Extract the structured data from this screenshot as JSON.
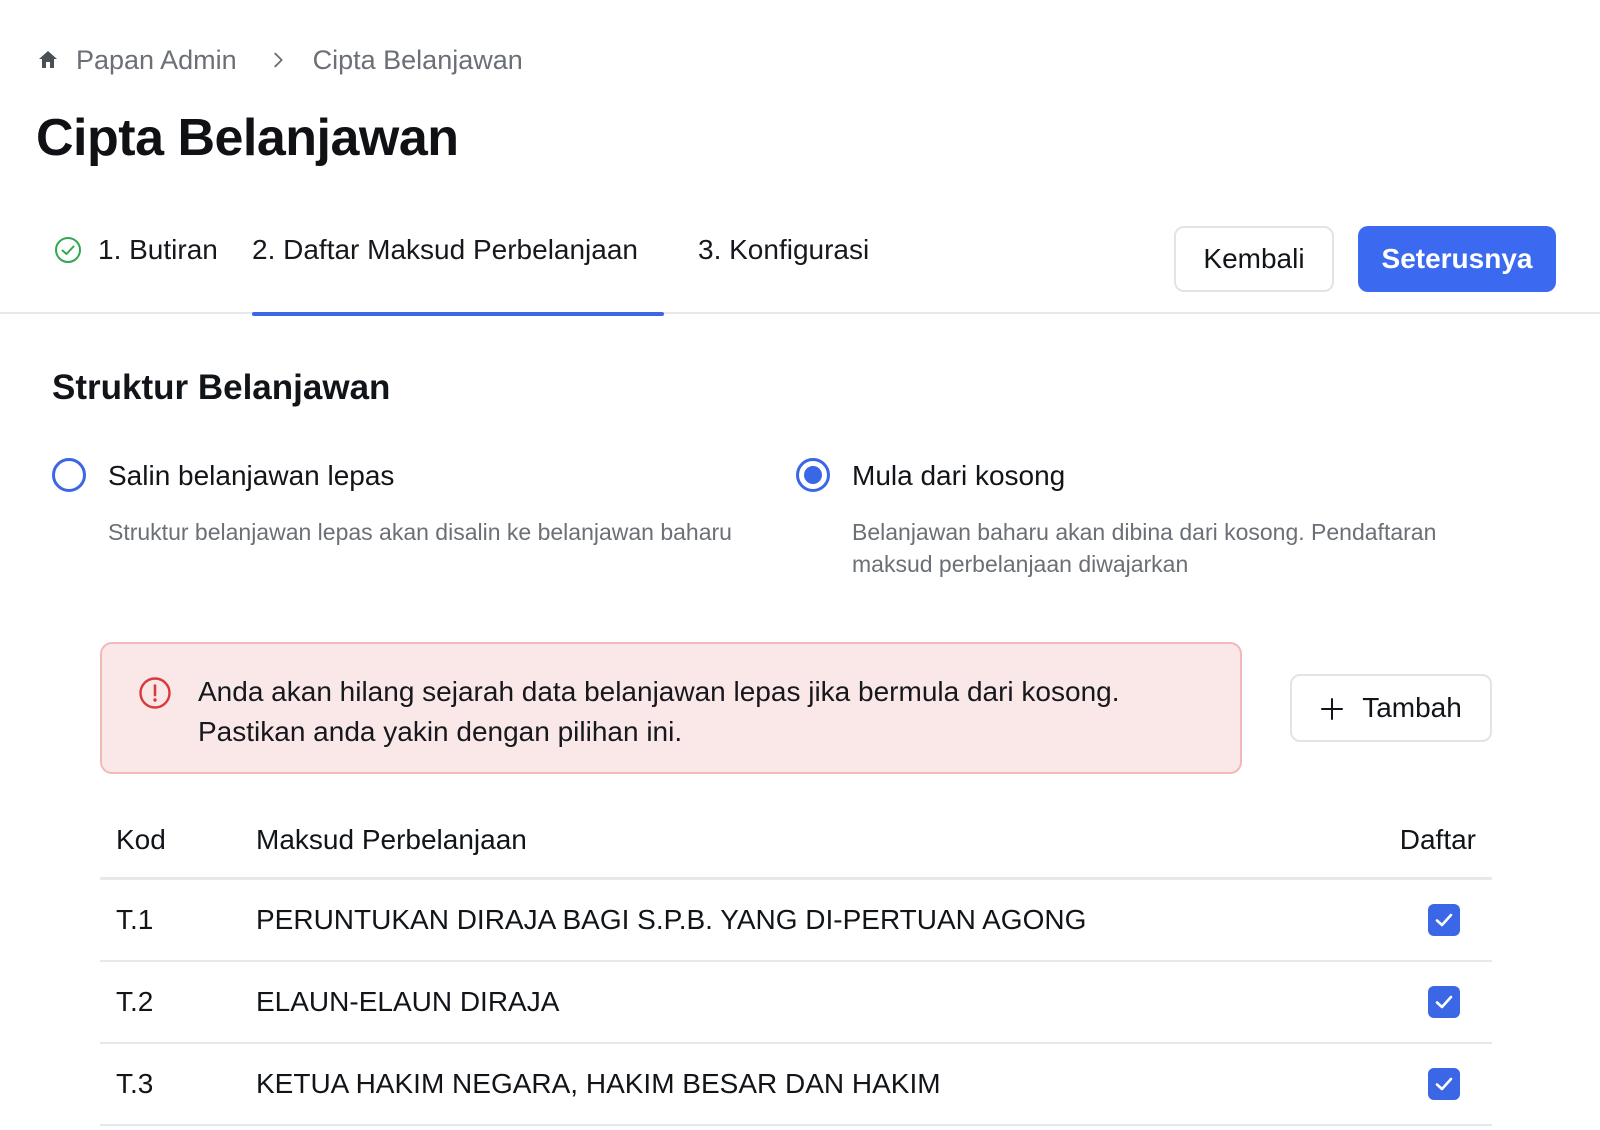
{
  "breadcrumb": {
    "home_label": "Papan Admin",
    "current_label": "Cipta Belanjawan"
  },
  "page": {
    "title": "Cipta Belanjawan"
  },
  "tabs": [
    {
      "label": "1. Butiran",
      "state": "completed"
    },
    {
      "label": "2. Daftar Maksud Perbelanjaan",
      "state": "active"
    },
    {
      "label": "3. Konfigurasi",
      "state": "pending"
    }
  ],
  "actions": {
    "back_label": "Kembali",
    "next_label": "Seterusnya"
  },
  "section": {
    "title": "Struktur Belanjawan"
  },
  "options": [
    {
      "label": "Salin belanjawan lepas",
      "description": "Struktur belanjawan lepas akan disalin ke belanjawan baharu",
      "selected": false
    },
    {
      "label": "Mula dari kosong",
      "description": "Belanjawan baharu akan dibina dari kosong. Pendaftaran maksud perbelanjaan diwajarkan",
      "selected": true
    }
  ],
  "alert": {
    "text": "Anda akan hilang sejarah data belanjawan lepas jika bermula dari kosong. Pastikan anda yakin dengan pilihan ini."
  },
  "add_button": {
    "label": "Tambah"
  },
  "table": {
    "headers": {
      "code": "Kod",
      "purpose": "Maksud Perbelanjaan",
      "list": "Daftar"
    },
    "rows": [
      {
        "code": "T.1",
        "purpose": "PERUNTUKAN DIRAJA BAGI S.P.B. YANG DI-PERTUAN AGONG",
        "listed": true
      },
      {
        "code": "T.2",
        "purpose": "ELAUN-ELAUN DIRAJA",
        "listed": true
      },
      {
        "code": "T.3",
        "purpose": "KETUA HAKIM NEGARA, HAKIM BESAR DAN HAKIM",
        "listed": true
      }
    ]
  },
  "colors": {
    "accent": "#3b66e6",
    "alert_bg": "#fae8e8",
    "alert_border": "#f2b8b8",
    "alert_icon": "#d93a3a",
    "success": "#2fa84f"
  }
}
